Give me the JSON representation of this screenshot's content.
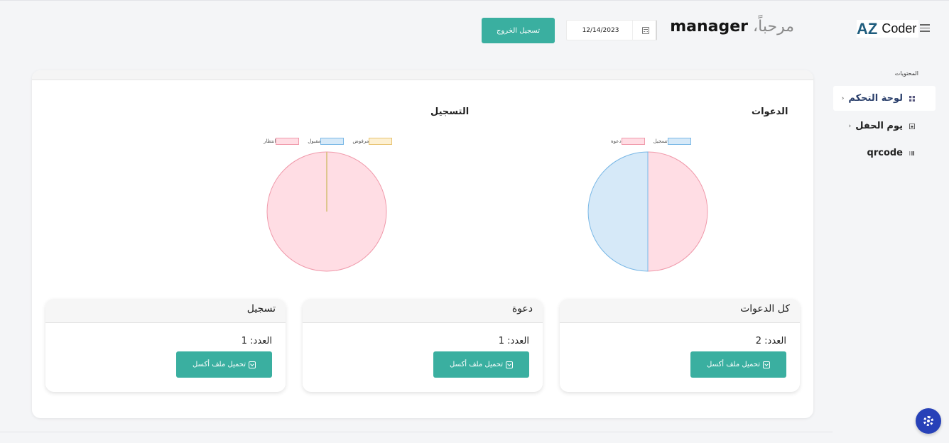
{
  "header": {
    "logout_label": "تسجيل الخروج",
    "date_value": "12/14/2023",
    "welcome_word": "مرحباً،",
    "username": "manager",
    "logo_az": "AZ",
    "logo_coder": "Coder"
  },
  "sidebar": {
    "heading": "المحتويات",
    "items": [
      {
        "label": "لوحة التحكم",
        "icon": "grid-icon",
        "active": true,
        "caret": "‹"
      },
      {
        "label": "يوم الحفل",
        "icon": "calendar-icon",
        "active": false,
        "caret": "‹"
      },
      {
        "label": "qrcode",
        "icon": "barcode-icon",
        "active": false,
        "caret": ""
      }
    ]
  },
  "chart_data": [
    {
      "type": "pie",
      "title": "الدعوات",
      "legend": [
        "دعوة",
        "تسجيل"
      ],
      "values": [
        1,
        1
      ],
      "colors": [
        "#ffdde4",
        "#d6e9f8"
      ],
      "borders": [
        "#f09aab",
        "#7ab8e6"
      ]
    },
    {
      "type": "pie",
      "title": "التسجيل",
      "legend": [
        "انتظار",
        "مقبول",
        "مرفوض"
      ],
      "values": [
        1,
        0,
        0
      ],
      "colors": [
        "#ffdde4",
        "#d6e9f8",
        "#fdf0d2"
      ],
      "borders": [
        "#f09aab",
        "#7ab8e6",
        "#e8c472"
      ]
    }
  ],
  "cards": [
    {
      "title": "كل الدعوات",
      "count": "العدد: 2",
      "button": "تحميل ملف أكسل"
    },
    {
      "title": "دعوة",
      "count": "العدد: 1",
      "button": "تحميل ملف أكسل"
    },
    {
      "title": "تسجيل",
      "count": "العدد: 1",
      "button": "تحميل ملف أكسل"
    }
  ]
}
